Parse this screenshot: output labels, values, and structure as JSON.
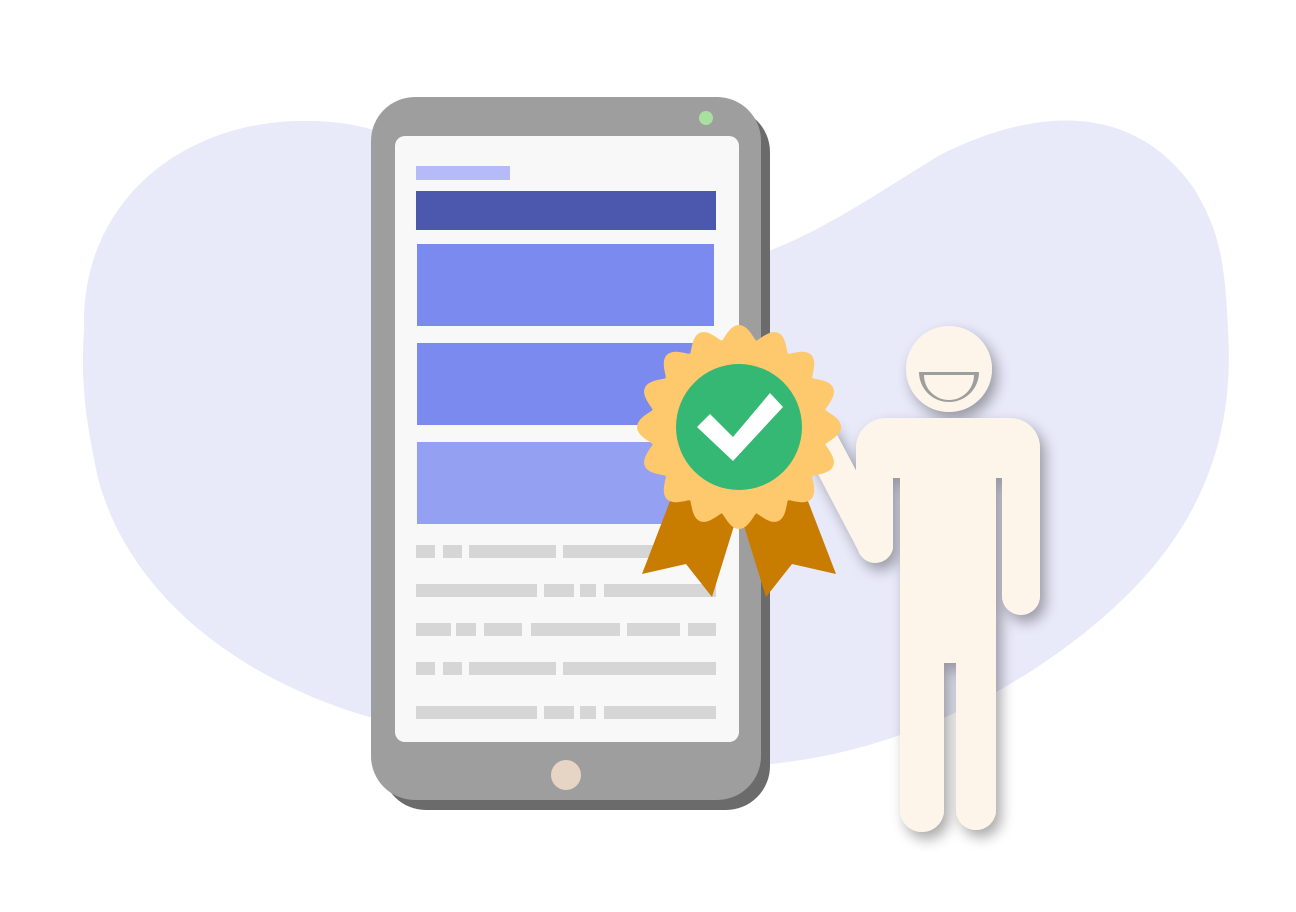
{
  "colors": {
    "background": "#ffffff",
    "blob": "#e8e9f9",
    "phone_body": "#9e9e9e",
    "phone_shadow": "#6b6b6b",
    "screen": "#f8f8f8",
    "camera_dot": "#a9e09f",
    "home_button": "#e6d5c5",
    "header_small": "#b4bbf8",
    "header_bar": "#4c57ae",
    "card_1": "#7a8aee",
    "card_2": "#7a8aee",
    "card_3": "#94a0f1",
    "text_lines": "#d6d6d6",
    "badge_rosette": "#fdc96c",
    "badge_circle": "#34b874",
    "badge_check": "#ffffff",
    "badge_ribbon": "#c87c00",
    "person_fill": "#fef5ea",
    "person_cutout": "#9e9e9e"
  },
  "icons": {
    "badge": "approval-badge-icon",
    "check": "checkmark-icon",
    "person": "person-figure-icon",
    "phone": "smartphone-icon"
  }
}
